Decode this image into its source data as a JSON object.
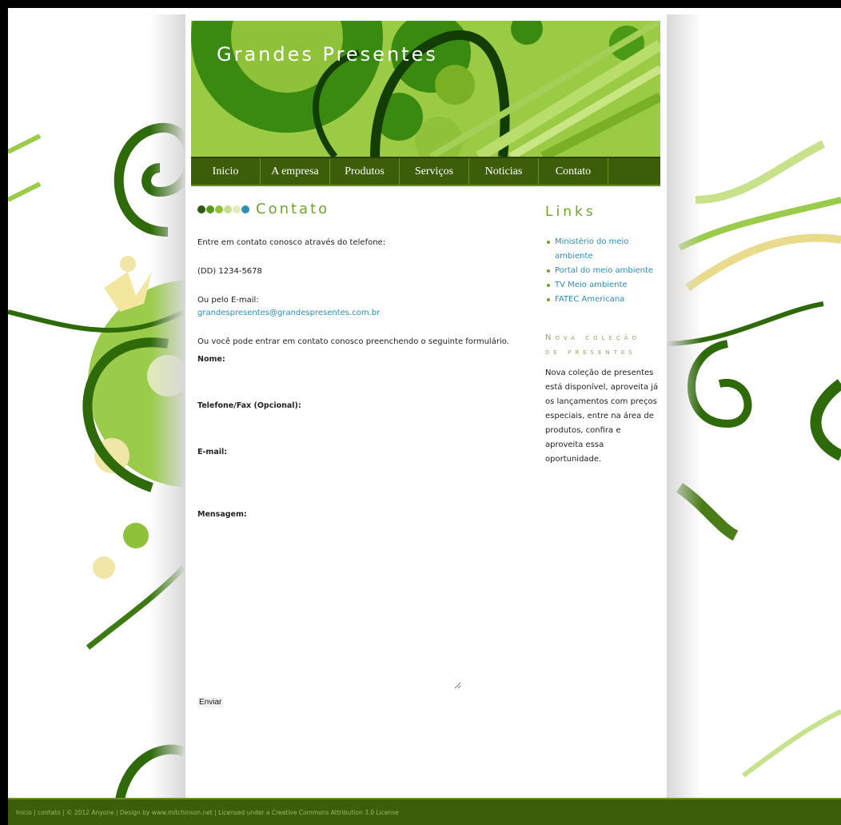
{
  "site": {
    "title": "Grandes Presentes"
  },
  "menu": [
    {
      "label": "Inicio"
    },
    {
      "label": "A empresa"
    },
    {
      "label": "Produtos"
    },
    {
      "label": "Serviços"
    },
    {
      "label": "Noticias"
    },
    {
      "label": "Contato"
    }
  ],
  "content": {
    "heading": "Contato",
    "intro": "Entre em contato conosco através do telefone:",
    "phone": "(DD) 1234-5678",
    "email_intro": "Ou pelo E-mail:",
    "email": "grandespresentes@grandespresentes.com.br",
    "form_intro": "Ou você pode entrar em contato conosco preenchendo o seguinte formulário.",
    "form": {
      "name_label": "Nome:",
      "phone_label": "Telefone/Fax (Opcional):",
      "email_label": "E-mail:",
      "message_label": "Mensagem:",
      "submit_label": "Enviar"
    }
  },
  "sidebar": {
    "links_title": "Links",
    "links": [
      {
        "label": "Ministério do meio ambiente"
      },
      {
        "label": "Portal do meio ambiente"
      },
      {
        "label": "TV Meio ambiente"
      },
      {
        "label": "FATEC Americana"
      }
    ],
    "news_title": "Nova coleção de presentes",
    "news_text": "Nova coleção de presentes está disponível, aproveita já os lançamentos com preços especiais, entre na área de produtos, confira e aproveita essa oportunidade."
  },
  "footer": {
    "text": "Inicio | contato | © 2012 Anyone | Design by www.mitchinson.net | Licensed under a Creative Commons Attribution 3.0 License"
  },
  "colors": {
    "menu_bg": "#3d5d0a",
    "accent": "#6fa42d",
    "link": "#2a8fb8",
    "dots": [
      "#2f5a0a",
      "#5a9a1a",
      "#8fc23a",
      "#c7df8a",
      "#e6ecb5",
      "#2a8fb8"
    ]
  }
}
